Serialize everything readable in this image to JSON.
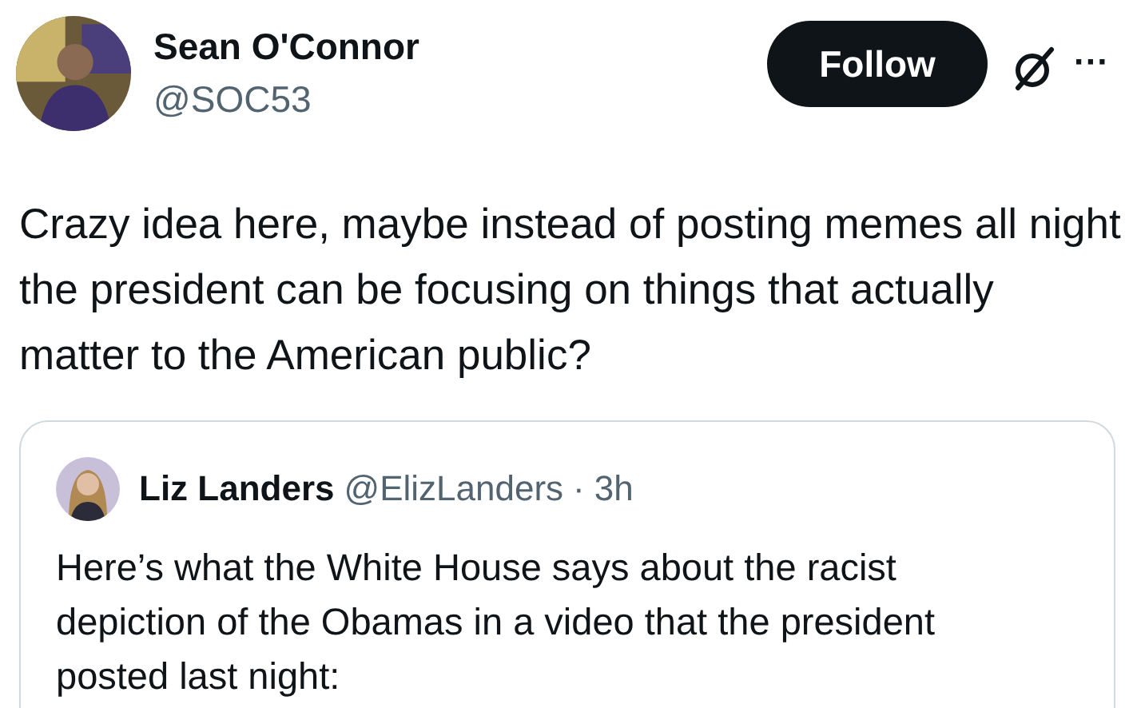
{
  "author": {
    "name": "Sean O'Connor",
    "handle": "@SOC53"
  },
  "follow_button": "Follow",
  "more_menu": "···",
  "text": "Crazy idea here, maybe instead of posting memes all night the president can be focusing on things that actually matter to the American public?",
  "quoted": {
    "name": "Liz Landers",
    "handle": "@ElizLanders",
    "separator": "·",
    "time": "3h",
    "text": "Here’s what the White House says about the racist depiction of the Obamas in a video that the president posted last night:"
  }
}
